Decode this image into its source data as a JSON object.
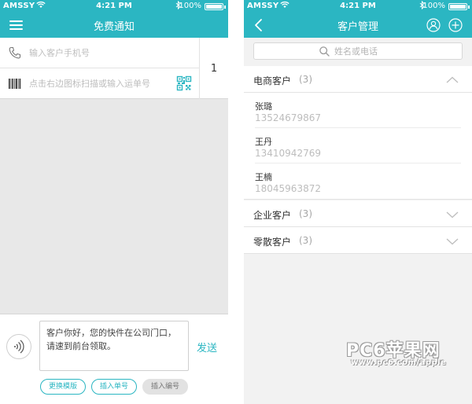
{
  "colors": {
    "accent": "#2bb6c2",
    "background": "#e8e8e8",
    "muted_text": "#bdbdbd"
  },
  "status_bar": {
    "carrier": "AMSSY",
    "time": "4:21 PM",
    "battery": "100%",
    "battery_level": 1.0
  },
  "left_screen": {
    "nav_title": "免费通知",
    "phone_input": {
      "placeholder": "输入客户手机号",
      "value": ""
    },
    "waybill_input": {
      "placeholder": "点击右边图标扫描或输入运单号",
      "value": ""
    },
    "count": "1",
    "message_text": "客户你好，您的快件在公司门口，请速到前台领取。",
    "send_label": "发送",
    "chips": [
      "更换模版",
      "插入单号",
      "插入编号"
    ]
  },
  "right_screen": {
    "nav_title": "客户管理",
    "search": {
      "placeholder": "姓名或电话",
      "value": ""
    },
    "groups": [
      {
        "name": "电商客户",
        "count": "(3)",
        "expanded": true,
        "contacts": [
          {
            "name": "张璐",
            "phone": "13524679867"
          },
          {
            "name": "王丹",
            "phone": "13410942769"
          },
          {
            "name": "王楠",
            "phone": "18045963872"
          }
        ]
      },
      {
        "name": "企业客户",
        "count": "(3)",
        "expanded": false
      },
      {
        "name": "零散客户",
        "count": "(3)",
        "expanded": false
      }
    ]
  },
  "watermark": {
    "big": "PC6苹果网",
    "small": "www.pc6.com/apple"
  }
}
